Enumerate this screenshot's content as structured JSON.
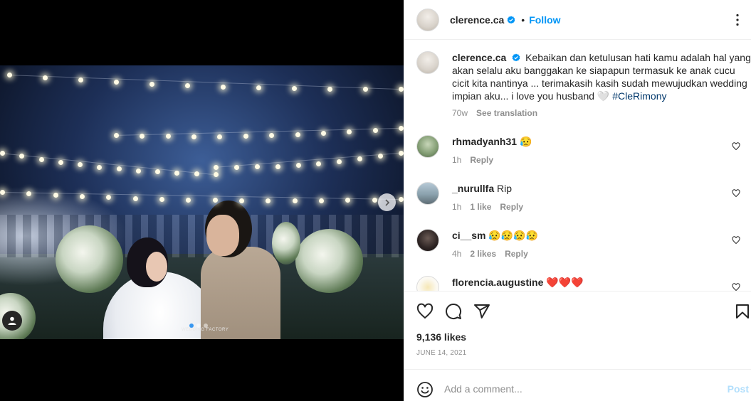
{
  "post": {
    "username": "clerence.ca",
    "follow_label": "Follow",
    "separator": "•",
    "verified": true,
    "caption": "Kebaikan dan ketulusan hati kamu adalah hal yang akan selalu aku banggakan ke siapapun termasuk ke anak cucu cicit kita nantinya ... terimakasih kasih sudah mewujudkan wedding impian aku... i love you husband 🤍",
    "caption_hashtag": "#CleRimony",
    "caption_age": "70w",
    "see_translation": "See translation",
    "photo_watermark": "WEDDING FACTORY",
    "carousel_count": 3,
    "carousel_active": 1
  },
  "comments": [
    {
      "username": "rhmadyanh31",
      "text": "😥",
      "age": "1h",
      "likes": "",
      "reply": "Reply"
    },
    {
      "username": "_nurullfa",
      "text": "Rip",
      "age": "1h",
      "likes": "1 like",
      "reply": "Reply"
    },
    {
      "username": "ci__sm",
      "text": "😥😥😥😥",
      "age": "4h",
      "likes": "2 likes",
      "reply": "Reply"
    },
    {
      "username": "florencia.augustine",
      "text": "❤️❤️❤️",
      "age": "",
      "likes": "",
      "reply": ""
    }
  ],
  "footer": {
    "likes": "9,136 likes",
    "date": "JUNE 14, 2021",
    "comment_placeholder": "Add a comment...",
    "post_label": "Post"
  },
  "colors": {
    "accent": "#0095f6",
    "hashtag": "#00376b",
    "muted": "#8e8e8e",
    "post_disabled": "#b2dffc"
  },
  "icons": [
    "verified-badge-icon",
    "more-options-icon",
    "next-arrow-icon",
    "tag-user-icon",
    "heart-icon",
    "comment-icon",
    "share-icon",
    "bookmark-icon",
    "emoji-icon"
  ]
}
